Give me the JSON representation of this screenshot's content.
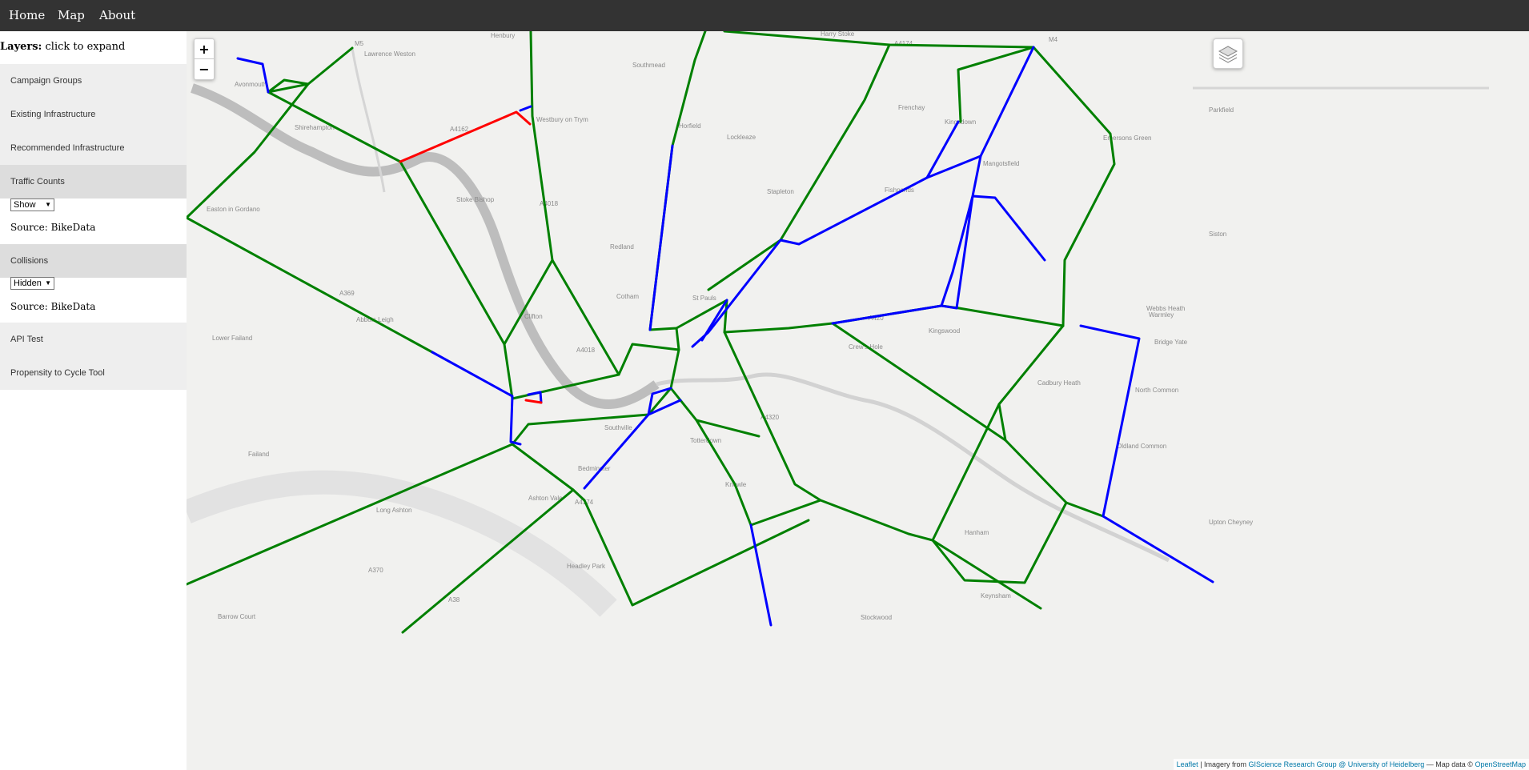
{
  "nav": {
    "items": [
      {
        "label": "Home"
      },
      {
        "label": "Map"
      },
      {
        "label": "About"
      }
    ]
  },
  "sidebar": {
    "layers_bold": "Layers:",
    "layers_hint": "click to expand",
    "groups": [
      {
        "label": "Campaign Groups"
      },
      {
        "label": "Existing Infrastructure"
      },
      {
        "label": "Recommended Infrastructure"
      },
      {
        "label": "Traffic Counts"
      },
      {
        "label": "Collisions"
      },
      {
        "label": "API Test"
      },
      {
        "label": "Propensity to Cycle Tool"
      }
    ],
    "traffic_counts": {
      "select_value": "Show",
      "source": "Source: BikeData"
    },
    "collisions": {
      "select_value": "Hidden",
      "source": "Source: BikeData"
    }
  },
  "map": {
    "zoom_in": "+",
    "zoom_out": "−",
    "attribution": {
      "leaflet": "Leaflet",
      "sep1": " | Imagery from ",
      "giscience": "GIScience Research Group @ University of Heidelberg",
      "sep2": " — Map data © ",
      "osm": "OpenStreetMap"
    },
    "labels": [
      "M5",
      "Lawrence Weston",
      "Henbury",
      "Southmead",
      "Harry Stoke",
      "A4174",
      "M4",
      "Avonmouth",
      "Shirehampton",
      "A4162",
      "Westbury on Trym",
      "Horfield",
      "Lockleaze",
      "Frenchay",
      "Stapleton",
      "Fishponds",
      "Stoke Bishop",
      "A4018",
      "Redland",
      "Easton in Gordano",
      "A369",
      "Abbots Leigh",
      "Clifton",
      "Cotham",
      "St Pauls",
      "A4018",
      "A420",
      "A4320",
      "Kingswood",
      "Crew's Hole",
      "Lower Failand",
      "A370",
      "Bedminster",
      "Southville",
      "Totterdown",
      "Knowle",
      "A4174",
      "Long Ashton",
      "Ashton Vale",
      "Failand",
      "Barrow Court",
      "A38",
      "Headley Park",
      "Keynsham",
      "Stockwood",
      "Warmley",
      "Bridge Yate",
      "North Common",
      "Oldland Common",
      "Upton Cheyney",
      "Parkfield",
      "Siston",
      "Webbs Heath",
      "Cadbury Heath",
      "Mangotsfield",
      "Emersons Green",
      "Kingsdown",
      "Hanham"
    ],
    "route_colors": {
      "green": "#008000",
      "blue": "#0000ff",
      "red": "#ff0000"
    }
  }
}
